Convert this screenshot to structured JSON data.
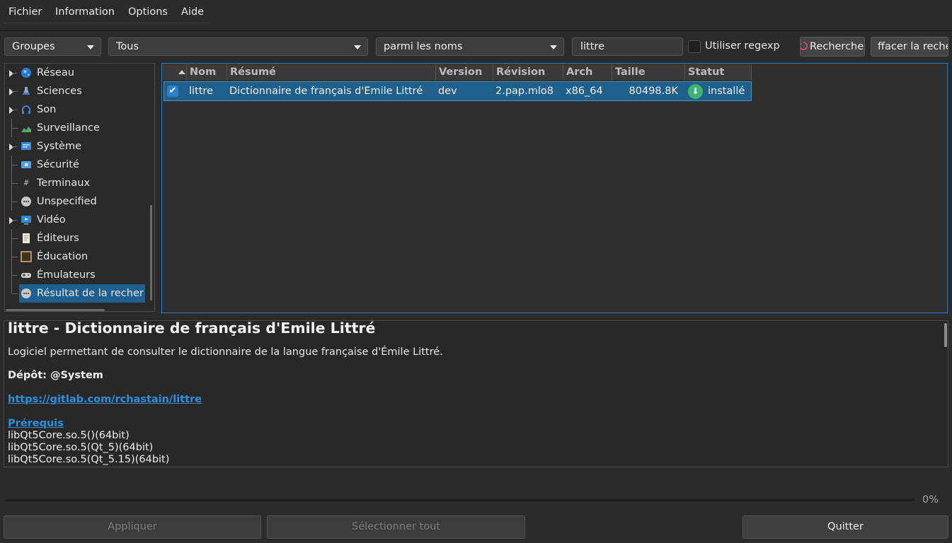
{
  "menubar": {
    "items": [
      "Fichier",
      "Information",
      "Options",
      "Aide"
    ]
  },
  "toolbar": {
    "group_combo": "Groupes",
    "filter_combo": "Tous",
    "scope_combo": "parmi les noms",
    "search_value": "littre",
    "regexp_label": "Utiliser regexp",
    "regexp_checked": false,
    "search_button": "Recherche",
    "clear_button": "ffacer la recher"
  },
  "sidebar": {
    "items": [
      {
        "label": "Réseau",
        "icon": "globe-icon",
        "expandable": true
      },
      {
        "label": "Sciences",
        "icon": "science-icon",
        "expandable": true
      },
      {
        "label": "Son",
        "icon": "headphones-icon",
        "expandable": true
      },
      {
        "label": "Surveillance",
        "icon": "monitoring-icon",
        "expandable": false
      },
      {
        "label": "Système",
        "icon": "system-icon",
        "expandable": true
      },
      {
        "label": "Sécurité",
        "icon": "security-icon",
        "expandable": false
      },
      {
        "label": "Terminaux",
        "icon": "terminal-icon",
        "expandable": false
      },
      {
        "label": "Unspecified",
        "icon": "dots-icon",
        "expandable": false
      },
      {
        "label": "Vidéo",
        "icon": "video-icon",
        "expandable": true
      },
      {
        "label": "Éditeurs",
        "icon": "editor-icon",
        "expandable": false
      },
      {
        "label": "Éducation",
        "icon": "education-icon",
        "expandable": false
      },
      {
        "label": "Émulateurs",
        "icon": "gamepad-icon",
        "expandable": false
      },
      {
        "label": "Résultat de la recher",
        "icon": "dots-icon",
        "expandable": false,
        "selected": true
      }
    ]
  },
  "table": {
    "columns": [
      "",
      "Nom",
      "Résumé",
      "Version",
      "Révision",
      "Arch",
      "Taille",
      "Statut"
    ],
    "rows": [
      {
        "checked": true,
        "name": "littre",
        "summary": "Dictionnaire de français d'Emile Littré",
        "version": "dev",
        "revision": "2.pap.mlo8",
        "arch": "x86_64",
        "size": "80498.8K",
        "status": "installé",
        "status_icon": "installed-icon"
      }
    ]
  },
  "details": {
    "title": "littre - Dictionnaire de français d'Emile Littré",
    "description": "Logiciel permettant de consulter le dictionnaire de la langue française d'Émile Littré.",
    "repo": "Dépôt: @System",
    "url": "https://gitlab.com/rchastain/littre",
    "prereq_label": "Prérequis",
    "deps": [
      "libQt5Core.so.5()(64bit)",
      "libQt5Core.so.5(Qt_5)(64bit)",
      "libQt5Core.so.5(Qt_5.15)(64bit)"
    ]
  },
  "progress": {
    "value": 0,
    "label": "0%"
  },
  "footer": {
    "apply": "Appliquer",
    "select_all": "Sélectionner tout",
    "quit": "Quitter"
  },
  "colors": {
    "accent": "#2f7bbd",
    "selection": "#1f5f8c",
    "link": "#2f8fd8",
    "installed": "#3cb371"
  }
}
